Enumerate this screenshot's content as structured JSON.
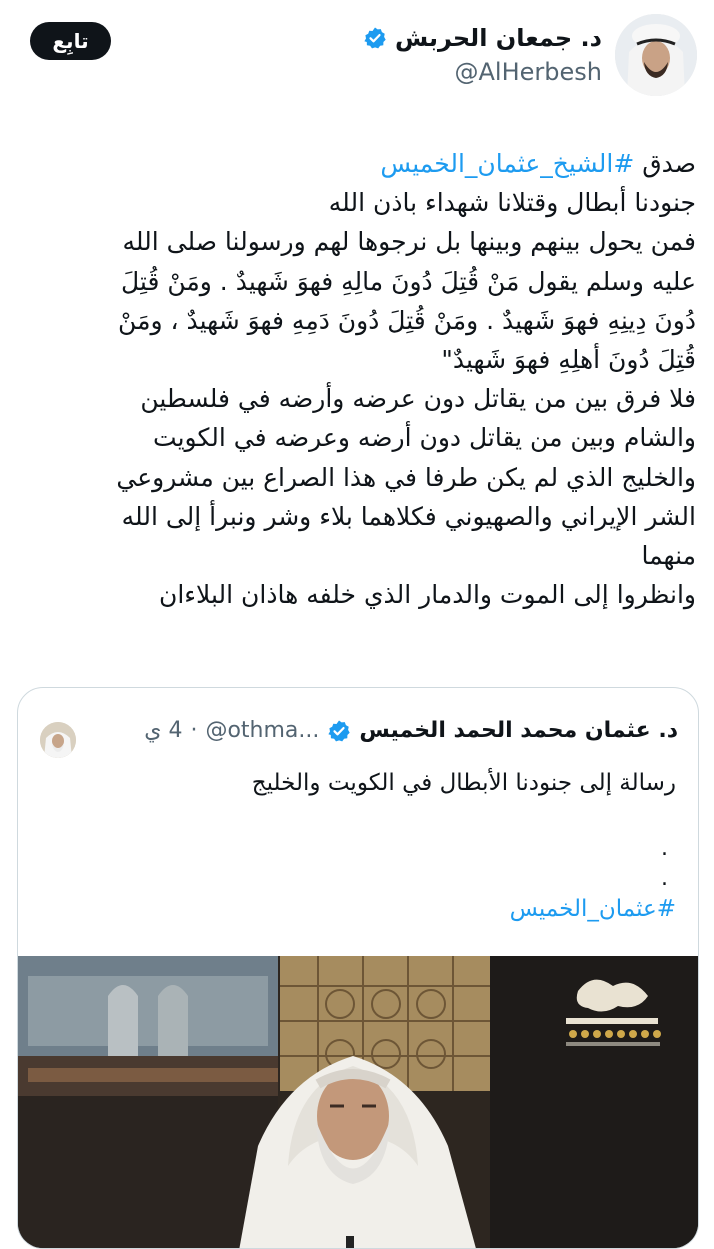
{
  "header": {
    "follow_label": "تابِع",
    "author_name": "د. جمعان الحربش",
    "author_handle": "@AlHerbesh"
  },
  "tweet": {
    "lines": [
      {
        "prefix": "صدق ",
        "hashtag": "#الشيخ_عثمان_الخميس"
      },
      {
        "text": "جنودنا أبطال وقتلانا شهداء باذن الله"
      },
      {
        "text": "فمن يحول بينهم وبينها بل نرجوها لهم ورسولنا  صلى الله"
      },
      {
        "text": "عليه وسلم يقول مَنْ قُتِلَ دُونَ مالِهِ فهوَ شَهيدٌ . ومَنْ قُتِلَ"
      },
      {
        "text": "دُونَ دِينِهِ فهوَ شَهيدٌ . ومَنْ قُتِلَ دُونَ دَمِهِ فهوَ شَهيدٌ ، ومَنْ"
      },
      {
        "text": "قُتِلَ دُونَ أهلِهِ فهوَ شَهيدٌ\""
      },
      {
        "text": "فلا فرق بين من يقاتل دون عرضه وأرضه في فلسطين"
      },
      {
        "text": "والشام وبين من يقاتل دون أرضه وعرضه في الكويت"
      },
      {
        "text": "والخليج الذي لم يكن طرفا في هذا الصراع بين مشروعي"
      },
      {
        "text": "الشر الإيراني والصهيوني فكلاهما بلاء وشر ونبرأ إلى الله"
      },
      {
        "text": "منهما"
      },
      {
        "text": "وانظروا  إلى الموت والدمار الذي خلفه هاذان البلاءان"
      }
    ]
  },
  "quote": {
    "author_name": "د. عثمان محمد الحمد الخميس",
    "handle": "@othma...",
    "separator": "·",
    "time": "4 ي",
    "text": "رسالة إلى جنودنا الأبطال في الكويت والخليج",
    "dots": [
      ".",
      "."
    ],
    "hashtag": "#عثمان_الخميس"
  },
  "colors": {
    "accent": "#1d9bf0",
    "text": "#0f1419",
    "secondary": "#536471",
    "border": "#cfd9de",
    "verified": "#1d9bf0"
  },
  "icons": [
    "verified-badge-icon"
  ]
}
